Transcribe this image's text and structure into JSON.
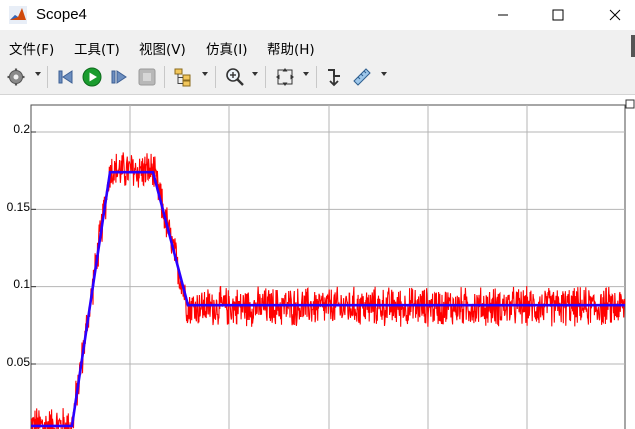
{
  "window": {
    "title": "Scope4",
    "controls": {
      "minimize": "minimize",
      "maximize": "maximize",
      "close": "close"
    }
  },
  "menu": {
    "items": [
      {
        "id": "file",
        "label": "文件(F)"
      },
      {
        "id": "tools",
        "label": "工具(T)"
      },
      {
        "id": "view",
        "label": "视图(V)"
      },
      {
        "id": "simulation",
        "label": "仿真(I)"
      },
      {
        "id": "help",
        "label": "帮助(H)"
      }
    ]
  },
  "toolbar": {
    "buttons": [
      {
        "id": "settings",
        "icon": "gear-icon",
        "dropdown": true
      },
      {
        "id": "step-back",
        "icon": "step-back-icon"
      },
      {
        "id": "run",
        "icon": "play-icon",
        "color": "#1a9c2e"
      },
      {
        "id": "step-forward",
        "icon": "step-forward-icon"
      },
      {
        "id": "stop",
        "icon": "stop-icon"
      },
      {
        "id": "layout",
        "icon": "signal-tree-icon",
        "dropdown": true
      },
      {
        "id": "zoom",
        "icon": "zoom-in-icon",
        "dropdown": true
      },
      {
        "id": "autoscale",
        "icon": "autoscale-icon",
        "dropdown": true
      },
      {
        "id": "triggers",
        "icon": "trigger-icon"
      },
      {
        "id": "measure",
        "icon": "ruler-icon",
        "dropdown": true
      }
    ]
  },
  "chart_data": {
    "type": "line",
    "ylim": [
      0.0,
      0.22
    ],
    "yticks": [
      0.05,
      0.1,
      0.15,
      0.2
    ],
    "ytick_labels": [
      "0.05",
      "0.1",
      "0.15",
      "0.2"
    ],
    "xlim": [
      0,
      6
    ],
    "xgrid": [
      1,
      2,
      3,
      4,
      5,
      6
    ],
    "grid": true,
    "series": [
      {
        "color": "#ff0000",
        "noisy": true,
        "noise_amplitude": 0.012,
        "x": [
          0.0,
          0.4,
          0.8,
          1.25,
          1.6,
          6.0
        ],
        "y": [
          0.01,
          0.01,
          0.175,
          0.175,
          0.087,
          0.087
        ]
      },
      {
        "color": "#2a00ff",
        "noisy": false,
        "x": [
          0.0,
          0.4,
          0.8,
          1.25,
          1.6,
          6.0
        ],
        "y": [
          0.01,
          0.01,
          0.174,
          0.174,
          0.088,
          0.088
        ]
      }
    ]
  }
}
